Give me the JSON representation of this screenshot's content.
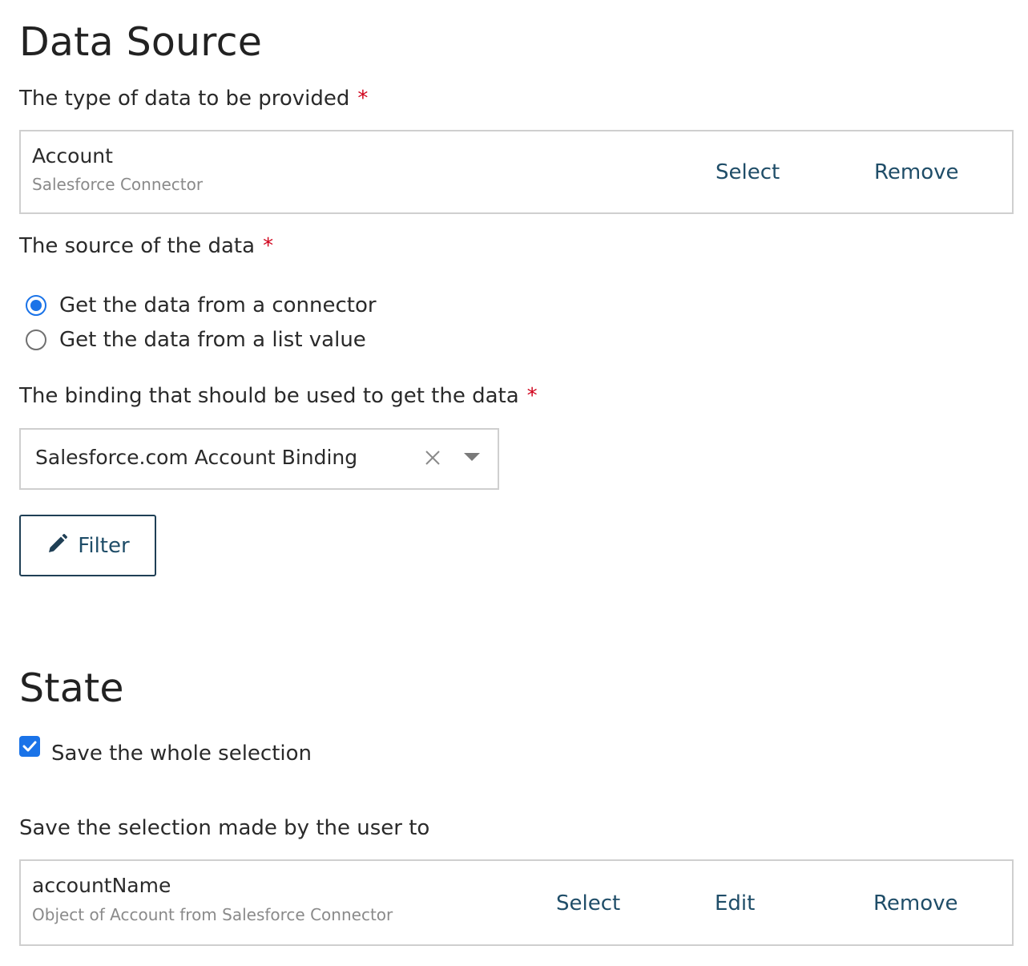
{
  "data_source": {
    "heading": "Data Source",
    "type_label": "The type of data to be provided",
    "type_value": {
      "primary": "Account",
      "secondary": "Salesforce Connector",
      "select_label": "Select",
      "remove_label": "Remove"
    },
    "source_label": "The source of the data",
    "source_options": [
      {
        "label": "Get the data from a connector",
        "checked": true
      },
      {
        "label": "Get the data from a list value",
        "checked": false
      }
    ],
    "binding_label": "The binding that should be used to get the data",
    "binding_value": "Salesforce.com Account Binding",
    "filter_label": "Filter",
    "required_mark": "*"
  },
  "state": {
    "heading": "State",
    "save_whole_label": "Save the whole selection",
    "save_whole_checked": true,
    "save_to_label": "Save the selection made by the user to",
    "save_to_value": {
      "primary": "accountName",
      "secondary": "Object of Account from Salesforce Connector",
      "select_label": "Select",
      "edit_label": "Edit",
      "remove_label": "Remove"
    }
  },
  "colors": {
    "accent": "#1a73e8",
    "link": "#1f4d68",
    "required": "#d0021b",
    "border": "#cfcfcf"
  },
  "icons": {
    "filter": "pencil-icon",
    "clear": "close-icon",
    "dropdown": "caret-down-icon",
    "checkbox": "checkmark-icon"
  }
}
